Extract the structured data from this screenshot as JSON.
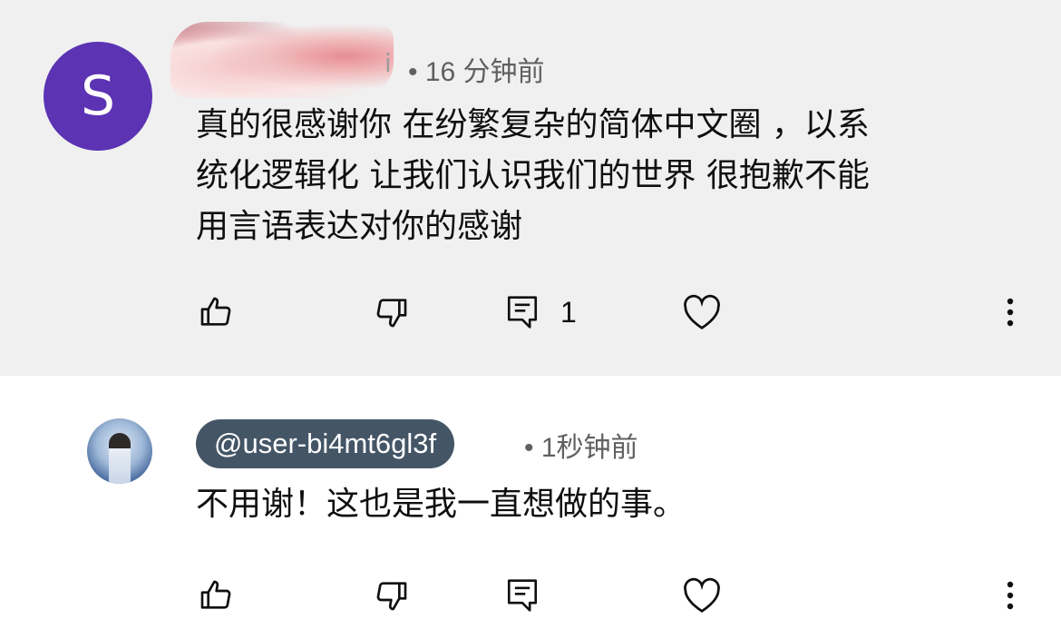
{
  "comments": [
    {
      "avatar_letter": "S",
      "avatar_color": "#5b33b3",
      "username_tail": "i",
      "time": "• 16 分钟前",
      "text": "真的很感谢你 在纷繁复杂的简体中文圈 ，以系\n统化逻辑化 让我们认识我们的世界 很抱歉不能\n用言语表达对你的感谢",
      "reply_count": "1",
      "bg_color": "#f0f0f0"
    },
    {
      "handle": "@user-bi4mt6gl3f",
      "handle_bg": "#445566",
      "time": "• 1秒钟前",
      "text": "不用谢！这也是我一直想做的事。",
      "bg_color": "#ffffff"
    }
  ],
  "icons": {
    "like": "thumbs-up-icon",
    "dislike": "thumbs-down-icon",
    "reply": "comment-icon",
    "heart": "heart-icon",
    "more": "more-vertical-icon"
  }
}
